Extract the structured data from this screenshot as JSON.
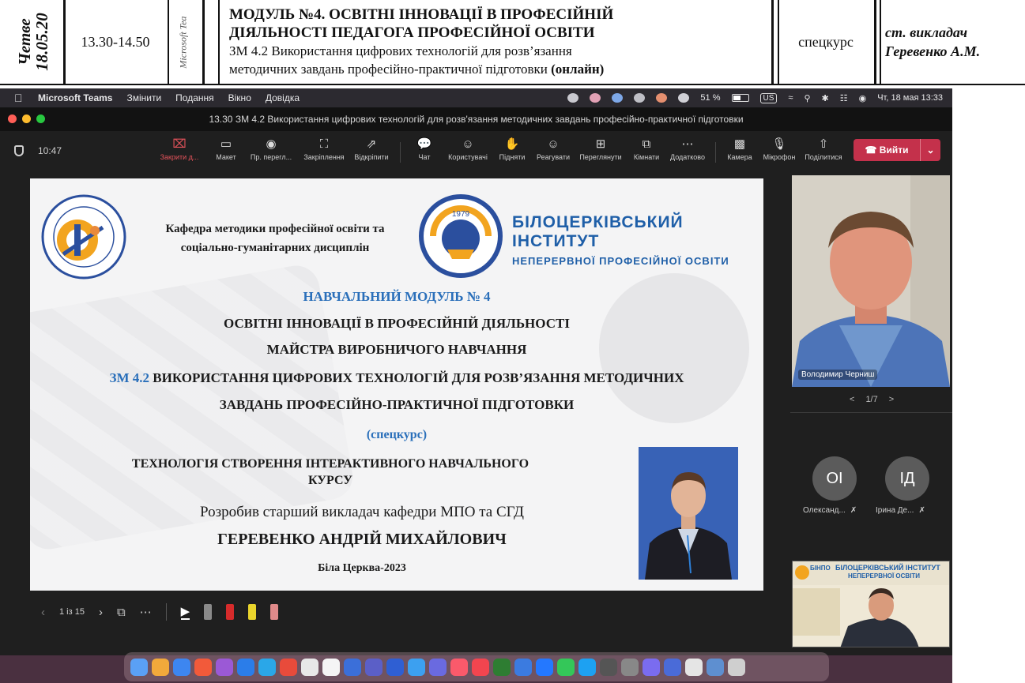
{
  "schedule": {
    "day": "Четве",
    "date": "18.05.20",
    "time": "13.30-14.50",
    "note": "Microsoft Tea",
    "module_line1": "МОДУЛЬ №4. ОСВІТНІ ІННОВАЦІЇ В ПРОФЕСІЙНІЙ",
    "module_line2": "ДІЯЛЬНОСТІ ПЕДАГОГА ПРОФЕСІЙНОЇ ОСВІТИ",
    "topic_line1": "ЗМ 4.2 Використання цифрових технологій для розв’язання",
    "topic_line2": "методичних завдань професійно-практичної підготовки",
    "topic_mode": "(онлайн)",
    "type": "спецкурс",
    "teacher_line1": "ст. викладач",
    "teacher_line2": "Геревенко А.М."
  },
  "menubar": {
    "app": "Microsoft Teams",
    "items": [
      "Змінити",
      "Подання",
      "Вікно",
      "Довідка"
    ],
    "battery": "51 %",
    "battery_level": 0.51,
    "keyboard": "US",
    "clock": "Чт, 18 мая  13:33"
  },
  "window": {
    "title": "13.30 ЗМ 4.2 Використання цифрових технологій для розв'язання методичних завдань професійно-практичної підготовки"
  },
  "toolbar": {
    "timer": "10:47",
    "buttons": {
      "close": "Закрити д...",
      "layout": "Макет",
      "preview": "Пр. перегл...",
      "pin": "Закріплення",
      "unpin": "Відкріпити",
      "chat": "Чат",
      "people": "Користувачі",
      "raise": "Підняти",
      "react": "Реагувати",
      "view": "Переглянути",
      "rooms": "Кімнати",
      "more": "Додатково",
      "camera": "Камера",
      "mic": "Мікрофон",
      "share": "Поділитися"
    },
    "leave": "Вийти"
  },
  "slide": {
    "dept_line1": "Кафедра методики професійної освіти та",
    "dept_line2": "соціально-гуманітарних дисциплін",
    "inst_line1": "БІЛОЦЕРКІВСЬКИЙ ІНСТИТУТ",
    "inst_line2": "НЕПЕРЕРВНОЇ ПРОФЕСІЙНОЇ ОСВІТИ",
    "module": "НАВЧАЛЬНИЙ МОДУЛЬ № 4",
    "innov1": "ОСВІТНІ ІННОВАЦІЇ В ПРОФЕСІЙНІЙ ДІЯЛЬНОСТІ",
    "innov2": "МАЙСТРА ВИРОБНИЧОГО НАВЧАННЯ",
    "zm_prefix": "ЗМ 4.2",
    "zm_line1": "ВИКОРИСТАННЯ ЦИФРОВИХ ТЕХНОЛОГІЙ ДЛЯ РОЗВ’ЯЗАННЯ МЕТОДИЧНИХ",
    "zm_line2": "ЗАВДАНЬ ПРОФЕСІЙНО-ПРАКТИЧНОЇ ПІДГОТОВКИ",
    "special": "(спецкурс)",
    "tech_line1": "ТЕХНОЛОГІЯ СТВОРЕННЯ ІНТЕРАКТИВНОГО НАВЧАЛЬНОГО",
    "tech_line2": "КУРСУ",
    "author_line": "Розробив старший викладач кафедри МПО та СГД",
    "author_name": "ГЕРЕВЕНКО АНДРІЙ МИХАЙЛОВИЧ",
    "place": "Біла Церква-2023",
    "logo_year": "1979"
  },
  "slide_controls": {
    "page": "1 із 15"
  },
  "participants": {
    "main_name": "Володимир Черниш",
    "pager": "1/7",
    "p1_initials": "ОІ",
    "p1_name": "Олександ...",
    "p2_initials": "ІД",
    "p2_name": "Ірина Де...",
    "self_banner1": "БІЛОЦЕРКІВСЬКИЙ ІНСТИТУТ",
    "self_banner2": "НЕПЕРЕРВНОЇ ОСВІТИ",
    "self_logo": "БІНПО"
  },
  "colors": {
    "leave_red": "#c4314b",
    "slide_blue": "#2a6fba",
    "avatar_gray": "#5b5b5b"
  }
}
